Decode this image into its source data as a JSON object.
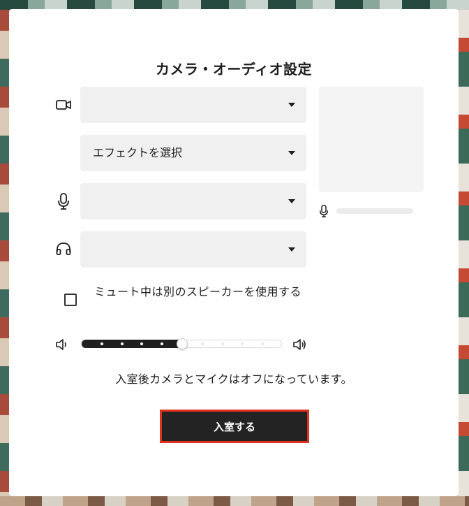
{
  "modal": {
    "title": "カメラ・オーディオ設定",
    "camera_select": {
      "value": ""
    },
    "effect_select": {
      "value": "エフェクトを選択"
    },
    "mic_select": {
      "value": ""
    },
    "speaker_select": {
      "value": ""
    },
    "mute_checkbox": {
      "checked": false,
      "label": "ミュート中は別のスピーカーを使用する"
    },
    "volume": {
      "level": 0.5
    },
    "mic_input_level": 0,
    "info_text": "入室後カメラとマイクはオフになっています。",
    "enter_button": "入室する"
  },
  "icons": {
    "camera": "video-camera-icon",
    "mic": "microphone-icon",
    "speaker": "headphones-icon",
    "volume_low": "volume-low-icon",
    "volume_high": "volume-high-icon"
  },
  "colors": {
    "button_bg": "#232323",
    "button_border": "#e0301e",
    "select_bg": "#f0f0f1",
    "slider_fill": "#1f1f1f"
  }
}
